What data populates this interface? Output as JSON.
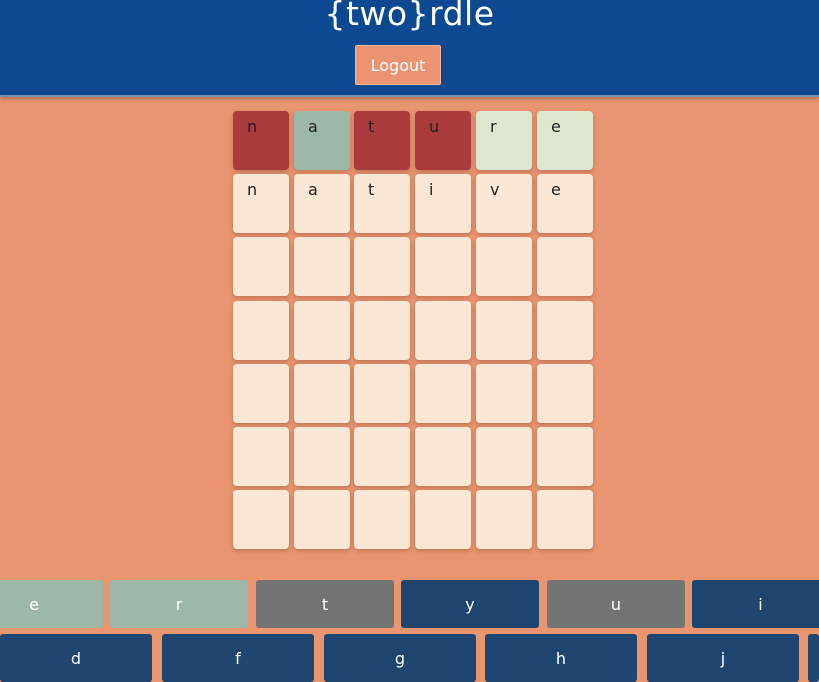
{
  "header": {
    "title": "{two}rdle",
    "logout_label": "Logout",
    "bg_color": "#0d4990"
  },
  "board": {
    "rows": [
      {
        "letters": [
          "n",
          "a",
          "t",
          "u",
          "r",
          "e"
        ],
        "states": [
          "absent",
          "present",
          "absent",
          "absent",
          "near",
          "near"
        ]
      },
      {
        "letters": [
          "n",
          "a",
          "t",
          "i",
          "v",
          "e"
        ],
        "states": [
          "typed",
          "typed",
          "typed",
          "typed",
          "typed",
          "typed"
        ]
      },
      {
        "letters": [
          "",
          "",
          "",
          "",
          "",
          ""
        ],
        "states": [
          "empty",
          "empty",
          "empty",
          "empty",
          "empty",
          "empty"
        ]
      },
      {
        "letters": [
          "",
          "",
          "",
          "",
          "",
          ""
        ],
        "states": [
          "empty",
          "empty",
          "empty",
          "empty",
          "empty",
          "empty"
        ]
      },
      {
        "letters": [
          "",
          "",
          "",
          "",
          "",
          ""
        ],
        "states": [
          "empty",
          "empty",
          "empty",
          "empty",
          "empty",
          "empty"
        ]
      },
      {
        "letters": [
          "",
          "",
          "",
          "",
          "",
          ""
        ],
        "states": [
          "empty",
          "empty",
          "empty",
          "empty",
          "empty",
          "empty"
        ]
      },
      {
        "letters": [
          "",
          "",
          "",
          "",
          "",
          ""
        ],
        "states": [
          "empty",
          "empty",
          "empty",
          "empty",
          "empty",
          "empty"
        ]
      }
    ],
    "colors": {
      "absent": "#a93b3d",
      "present": "#9db7a8",
      "near": "#dde6d1",
      "empty": "#fbe7d6"
    }
  },
  "keyboard": {
    "row1": [
      {
        "label": "e",
        "state": "sage"
      },
      {
        "label": "r",
        "state": "sage"
      },
      {
        "label": "t",
        "state": "grey"
      },
      {
        "label": "y",
        "state": "navy"
      },
      {
        "label": "u",
        "state": "grey"
      },
      {
        "label": "i",
        "state": "navy"
      }
    ],
    "row2": [
      {
        "label": "d",
        "state": "navy"
      },
      {
        "label": "f",
        "state": "navy"
      },
      {
        "label": "g",
        "state": "navy"
      },
      {
        "label": "h",
        "state": "navy"
      },
      {
        "label": "j",
        "state": "navy"
      }
    ]
  }
}
